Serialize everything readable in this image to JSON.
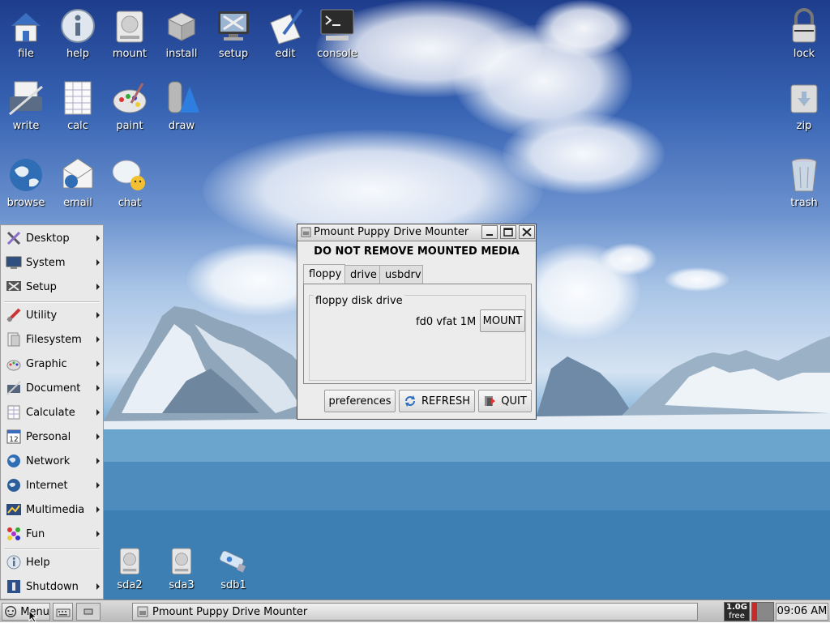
{
  "desktop": {
    "icons_top": [
      {
        "label": "file",
        "icon": "home-folder-icon"
      },
      {
        "label": "help",
        "icon": "info-icon"
      },
      {
        "label": "mount",
        "icon": "drive-icon"
      },
      {
        "label": "install",
        "icon": "package-box-icon"
      },
      {
        "label": "setup",
        "icon": "monitor-tools-icon"
      },
      {
        "label": "edit",
        "icon": "pen-paper-icon"
      },
      {
        "label": "console",
        "icon": "terminal-icon"
      }
    ],
    "icons_row2": [
      {
        "label": "write",
        "icon": "typewriter-icon"
      },
      {
        "label": "calc",
        "icon": "spreadsheet-icon"
      },
      {
        "label": "paint",
        "icon": "palette-icon"
      },
      {
        "label": "draw",
        "icon": "shapes-icon"
      }
    ],
    "icons_row3": [
      {
        "label": "browse",
        "icon": "globe-icon"
      },
      {
        "label": "email",
        "icon": "envelope-icon"
      },
      {
        "label": "chat",
        "icon": "chat-bubble-icon"
      }
    ],
    "icons_right": [
      {
        "label": "lock",
        "icon": "padlock-icon"
      },
      {
        "label": "zip",
        "icon": "archive-icon"
      },
      {
        "label": "trash",
        "icon": "trash-can-icon"
      }
    ],
    "drives": [
      {
        "label": "sda2",
        "icon": "hard-drive-icon"
      },
      {
        "label": "sda3",
        "icon": "hard-drive-icon"
      },
      {
        "label": "sdb1",
        "icon": "usb-drive-icon"
      }
    ]
  },
  "menu": {
    "items": [
      {
        "label": "Desktop",
        "icon": "desktop-x-icon"
      },
      {
        "label": "System",
        "icon": "system-monitor-icon"
      },
      {
        "label": "Setup",
        "icon": "setup-tools-icon"
      },
      {
        "label": "Utility",
        "icon": "utility-tools-icon"
      },
      {
        "label": "Filesystem",
        "icon": "filesystem-icon"
      },
      {
        "label": "Graphic",
        "icon": "graphic-icon"
      },
      {
        "label": "Document",
        "icon": "document-icon"
      },
      {
        "label": "Calculate",
        "icon": "calculator-icon"
      },
      {
        "label": "Personal",
        "icon": "calendar-icon"
      },
      {
        "label": "Network",
        "icon": "network-icon"
      },
      {
        "label": "Internet",
        "icon": "internet-globe-icon"
      },
      {
        "label": "Multimedia",
        "icon": "multimedia-icon"
      },
      {
        "label": "Fun",
        "icon": "fun-icon"
      },
      {
        "label": "Help",
        "icon": "help-icon"
      },
      {
        "label": "Shutdown",
        "icon": "shutdown-icon"
      }
    ]
  },
  "dialog": {
    "title": "Pmount Puppy Drive Mounter",
    "heading": "DO NOT REMOVE MOUNTED MEDIA",
    "tabs": [
      "floppy",
      "drive",
      "usbdrv"
    ],
    "frame_label": "floppy disk drive",
    "device_info": "fd0 vfat 1M",
    "mount_label": "MOUNT",
    "buttons": {
      "preferences": "preferences",
      "refresh": "REFRESH",
      "quit": "QUIT"
    }
  },
  "taskbar": {
    "menu_label": "Menu",
    "task_title": "Pmount Puppy Drive Mounter",
    "free_size": "1.0G",
    "free_label": "free",
    "clock": "09:06 AM"
  }
}
